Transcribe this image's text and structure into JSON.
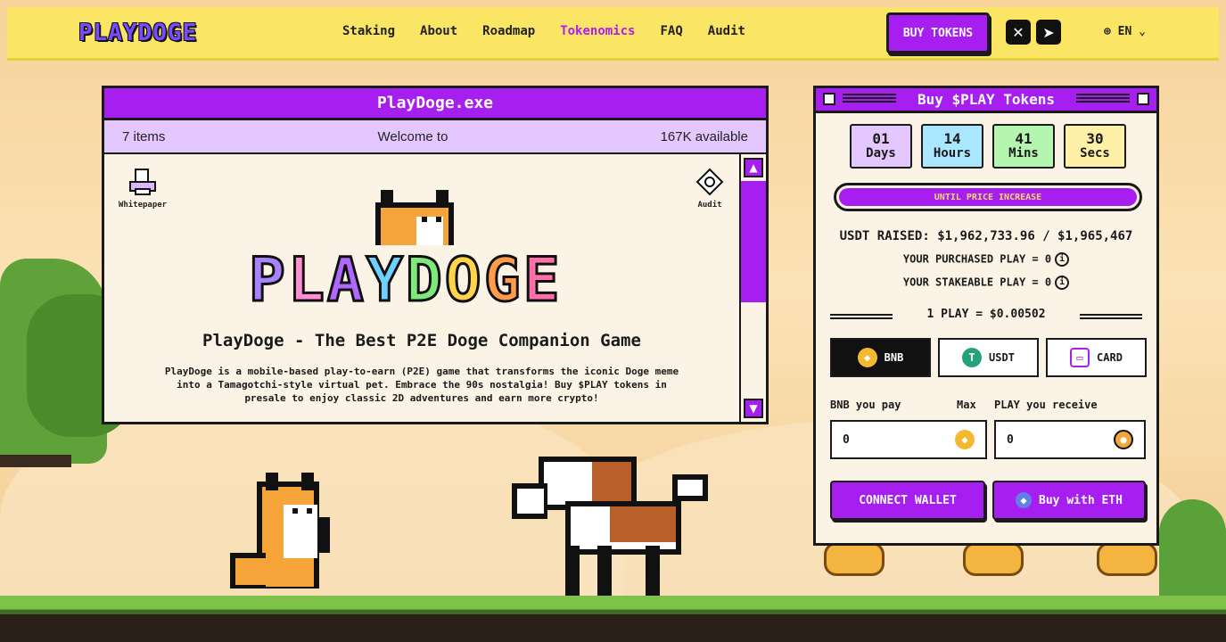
{
  "header": {
    "logo": "PLAYDOGE",
    "nav": [
      "Staking",
      "About",
      "Roadmap",
      "Tokenomics",
      "FAQ",
      "Audit"
    ],
    "active_nav": "Tokenomics",
    "buy_label": "BUY TOKENS",
    "social_x": "X",
    "social_telegram": "telegram",
    "language": "EN"
  },
  "window": {
    "title": "PlayDoge.exe",
    "items": "7 items",
    "welcome": "Welcome to",
    "available": "167K available",
    "icons": [
      "Whitepaper",
      "Audit"
    ],
    "logo_text": "PLAYDOGE",
    "headline": "PlayDoge - The Best P2E Doge Companion Game",
    "description": "PlayDoge is a mobile-based play-to-earn (P2E) game that transforms the iconic Doge meme into a Tamagotchi-style virtual pet. Embrace the 90s nostalgia! Buy $PLAY tokens in presale to enjoy classic 2D adventures and earn more crypto!"
  },
  "presale": {
    "title": "Buy $PLAY Tokens",
    "countdown": [
      {
        "value": "01",
        "unit": "Days",
        "color": "#e4c7ff"
      },
      {
        "value": "14",
        "unit": "Hours",
        "color": "#a9e6ff"
      },
      {
        "value": "41",
        "unit": "Mins",
        "color": "#b4f5b0"
      },
      {
        "value": "30",
        "unit": "Secs",
        "color": "#fff0a8"
      }
    ],
    "until_label": "UNTIL PRICE INCREASE",
    "raised": "USDT RAISED: $1,962,733.96 / $1,965,467",
    "purchased": "YOUR PURCHASED PLAY = 0",
    "stakeable": "YOUR STAKEABLE PLAY = 0",
    "rate": "1 PLAY = $0.00502",
    "pay_options": [
      {
        "label": "BNB",
        "icon": "bnb-icon",
        "selected": true
      },
      {
        "label": "USDT",
        "icon": "usdt-icon",
        "selected": false
      },
      {
        "label": "CARD",
        "icon": "card-icon",
        "selected": false
      }
    ],
    "pay_label": "BNB you pay",
    "max_label": "Max",
    "receive_label": "PLAY you receive",
    "pay_value": "0",
    "receive_value": "0",
    "connect_label": "CONNECT WALLET",
    "eth_label": "Buy with ETH"
  },
  "colors": {
    "purple": "#a71ff0",
    "header_yellow": "#fae564",
    "active_nav": "#b31bf0"
  }
}
